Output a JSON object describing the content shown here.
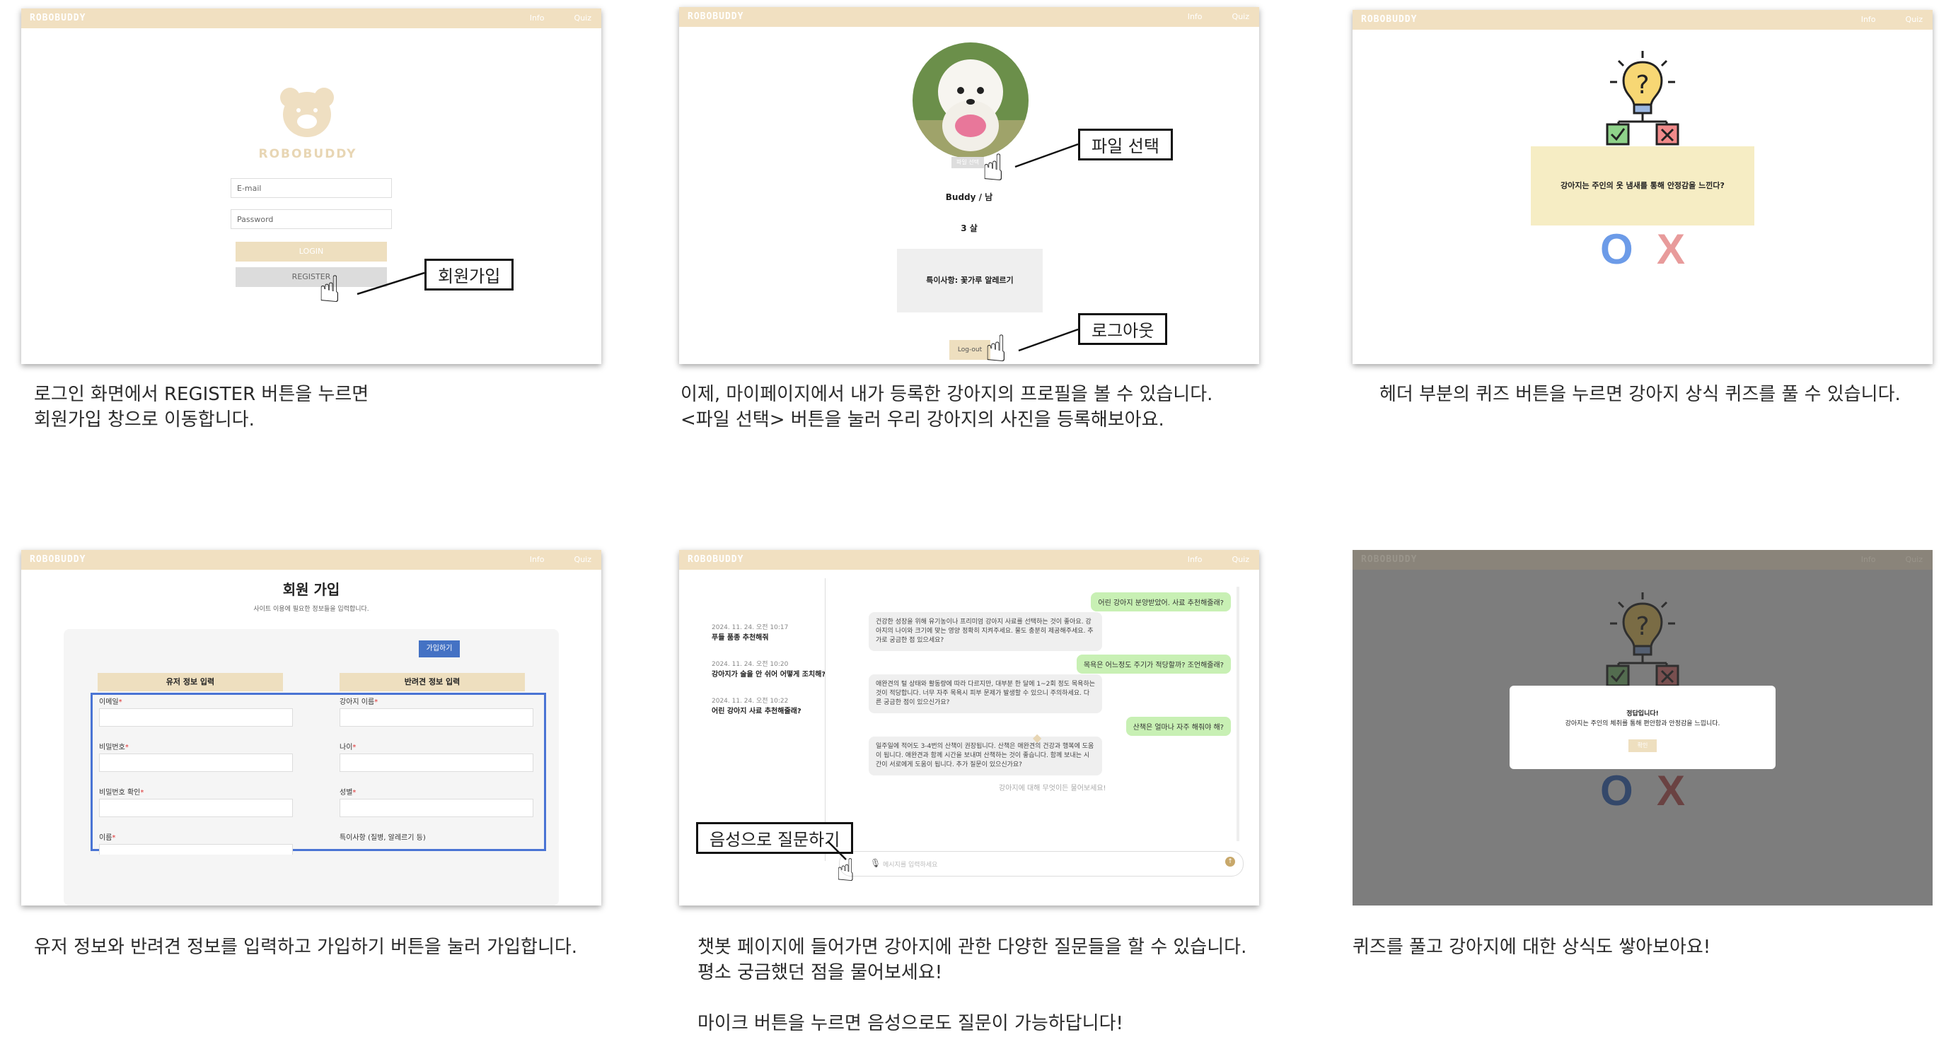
{
  "app": {
    "logo": "ROBOBUDDY",
    "nav": [
      "Info",
      "Quiz"
    ]
  },
  "panel1": {
    "brand": "ROBOBUDDY",
    "email_placeholder": "E-mail",
    "password_placeholder": "Password",
    "login_label": "LOGIN",
    "register_label": "REGISTER",
    "callout": "회원가입",
    "caption": "로그인 화면에서 REGISTER 버튼을 누르면\n회원가입 창으로 이동합니다."
  },
  "panel2": {
    "file_button": "파일 선택",
    "name_gender": "Buddy / 남",
    "age": "3 살",
    "notes": "특이사항: 꽃가루 알레르기",
    "logout_label": "Log-out",
    "callout_file": "파일 선택",
    "callout_logout": "로그아웃",
    "caption": "이제, 마이페이지에서 내가 등록한 강아지의 프로필을 볼 수 있습니다.\n<파일 선택> 버튼을 눌러 우리 강아지의 사진을 등록해보아요."
  },
  "panel3": {
    "question": "강아지는 주인의 옷 냄새를 통해 안정감을 느낀다?",
    "o_label": "O",
    "x_label": "X",
    "caption": "헤더 부분의 퀴즈 버튼을 누르면 강아지 상식 퀴즈를 풀 수 있습니다."
  },
  "panel4": {
    "title": "회원 가입",
    "subtitle": "사이트 이용에 필요한 정보들을 입력합니다.",
    "submit_label": "가입하기",
    "user_header": "유저 정보 입력",
    "pet_header": "반려견 정보 입력",
    "user_fields": [
      "이메일",
      "비밀번호",
      "비밀번호 확인",
      "이름"
    ],
    "pet_fields": [
      "강아지 이름",
      "나이",
      "성별",
      "특이사항 (질병, 알레르기 등)"
    ],
    "caption": "유저 정보와 반려견 정보를 입력하고 가입하기 버튼을 눌러 가입합니다."
  },
  "panel5": {
    "history": [
      {
        "date": "2024. 11. 24. 오전 10:17",
        "title": "푸들 품종 추천해줘"
      },
      {
        "date": "2024. 11. 24. 오전 10:20",
        "title": "강아지가 술을 안 쉬어 어떻게 조치해?"
      },
      {
        "date": "2024. 11. 24. 오전 10:22",
        "title": "어린 강아지 사료 추천해줄래?"
      }
    ],
    "messages": [
      {
        "role": "user",
        "text": "어린 강아지 분양받았어. 사료 추천해줄래?"
      },
      {
        "role": "bot",
        "text": "건강한 성장을 위해 유기농이나 프리미엄 강아지 사료를 선택하는 것이 좋아요. 강아지의 나이와 크기에 맞는 영양 정확히 지켜주세요. 물도 충분히 제공해주세요. 추가로 궁금한 점 있으세요?"
      },
      {
        "role": "user",
        "text": "목욕은 어느정도 주기가 적당할까? 조언해줄래?"
      },
      {
        "role": "bot",
        "text": "애완견의 털 상태와 활동량에 따라 다르지만, 대부분 한 달에 1~2회 정도 목욕하는 것이 적당합니다. 너무 자주 목욕시 피부 문제가 발생할 수 있으니 주의하세요. 다른 궁금한 점이 있으신가요?"
      },
      {
        "role": "user",
        "text": "산책은 얼마나 자주 해줘야 해?"
      },
      {
        "role": "bot",
        "text": "일주일에 적어도 3-4번의 산책이 권장됩니다. 산책은 애완견의 건강과 행복에 도움이 됩니다. 애완견과 함께 시간을 보내며 산책하는 것이 좋습니다. 함께 보내는 시간이 서로에게 도움이 됩니다. 추가 질문이 있으신가요?"
      }
    ],
    "thinking": "강아지에 대해 무엇이든 물어보세요!",
    "input_placeholder": "메시지를 입력하세요",
    "callout": "음성으로 질문하기",
    "caption": "챗봇 페이지에 들어가면 강아지에 관한 다양한 질문들을 할 수 있습니다.\n평소 궁금했던 점을 물어보세요!\n\n마이크 버튼을 누르면 음성으로도 질문이 가능하답니다!"
  },
  "panel6": {
    "result_title": "정답입니다!",
    "result_text": "강아지는 주인의 체취를 통해 편안함과 안정감을 느낍니다.",
    "confirm_label": "확인",
    "o_label": "O",
    "x_label": "X",
    "caption": "퀴즈를 풀고 강아지에 대한 상식도 쌓아보아요!"
  },
  "colors": {
    "header": "#f1e0c1",
    "accent_blue": "#4472c4",
    "o_color": "#6c9be8",
    "x_color": "#e89b9b"
  }
}
